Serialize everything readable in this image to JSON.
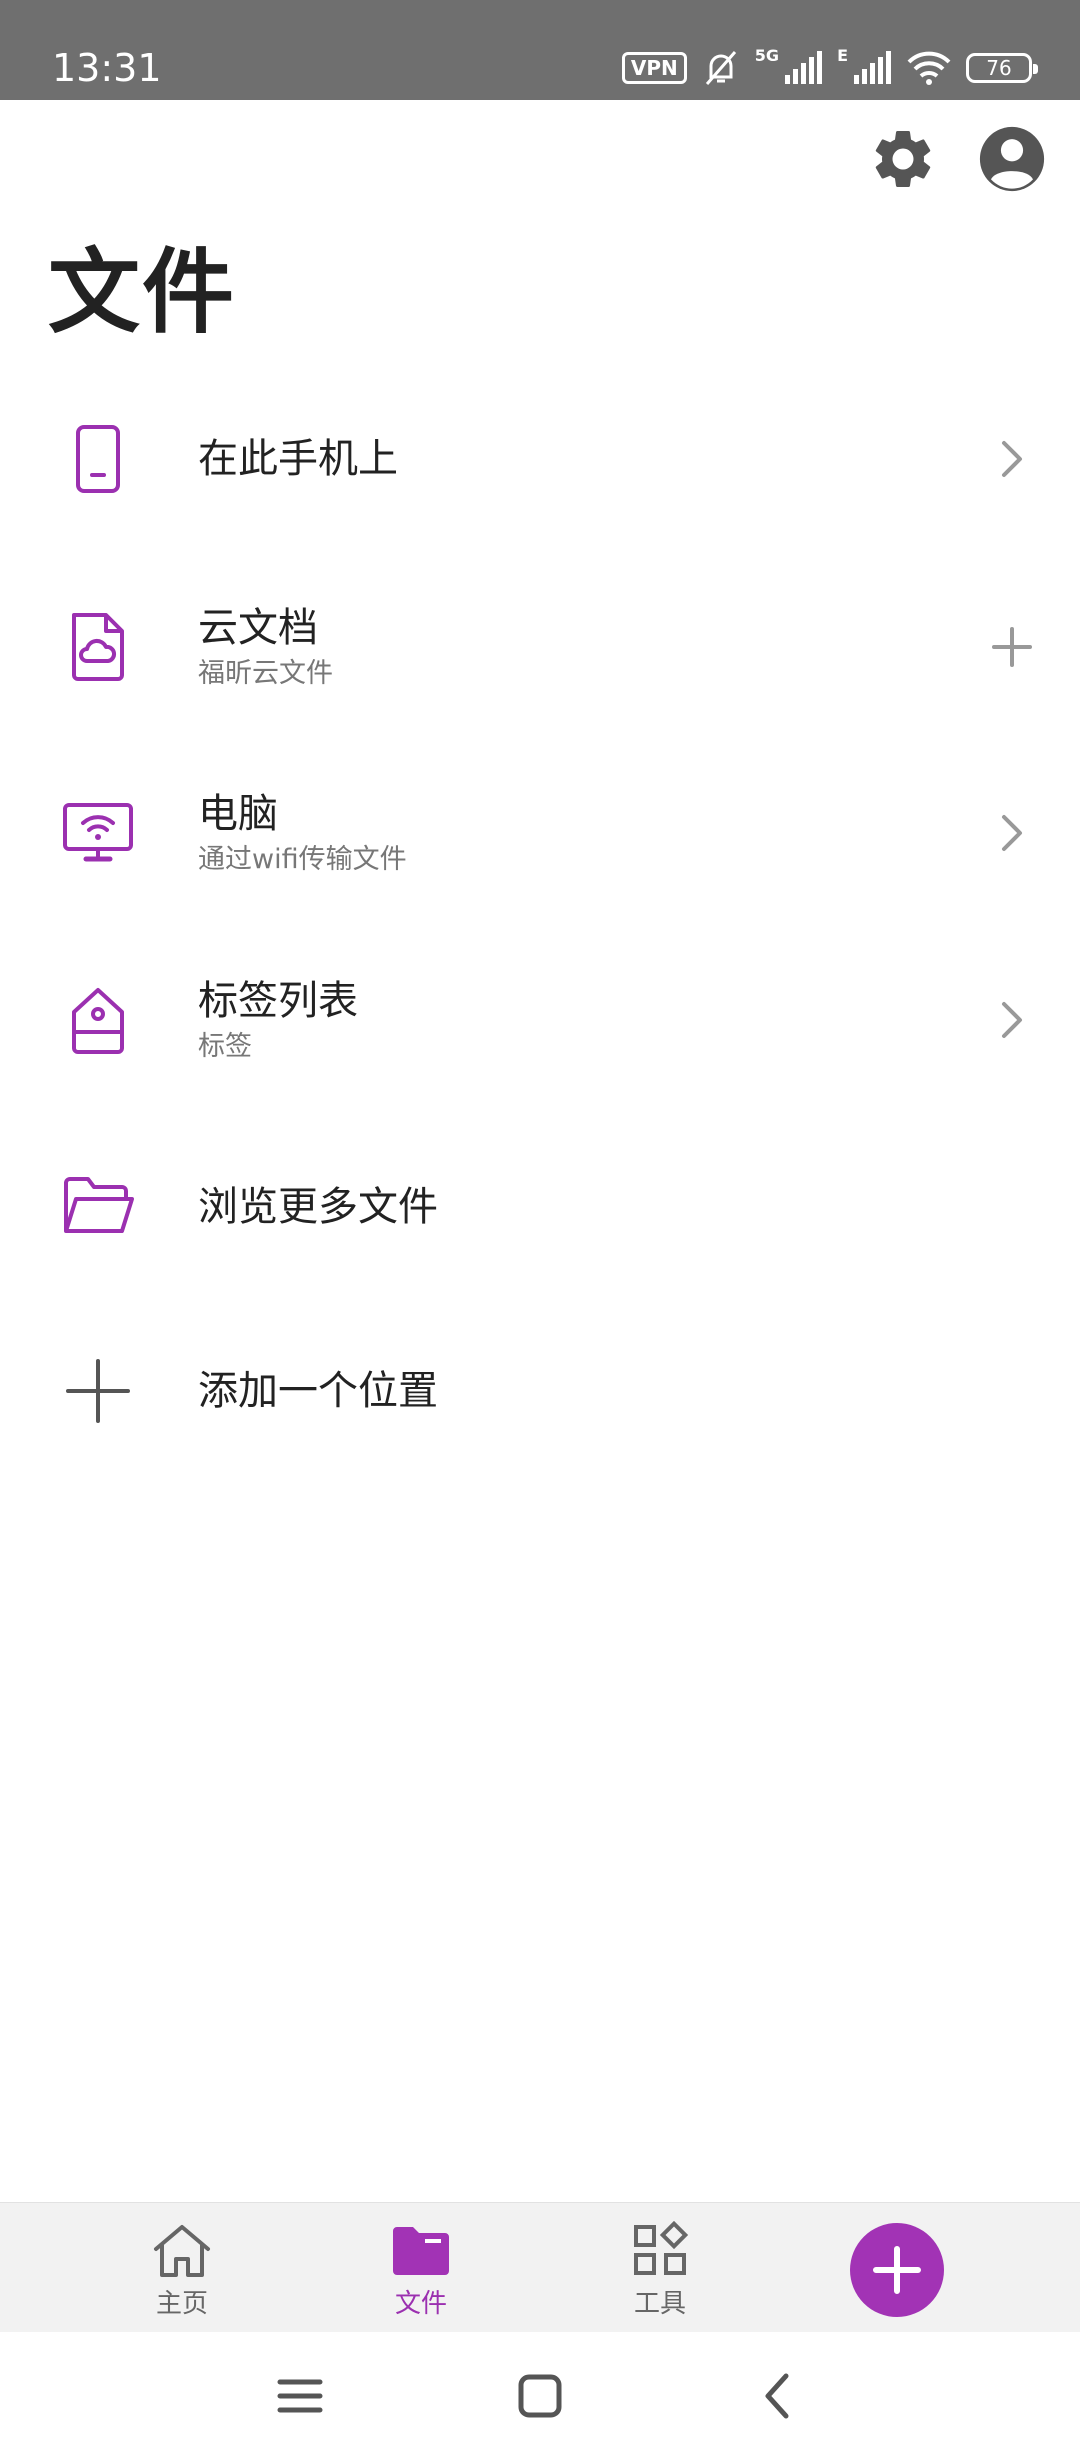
{
  "status_bar": {
    "time": "13:31",
    "vpn": "VPN",
    "net_5g": "5G",
    "net_e": "E",
    "battery": "76"
  },
  "header": {
    "settings_icon": "gear-icon",
    "account_icon": "account-circle-icon"
  },
  "page": {
    "title": "文件"
  },
  "locations": [
    {
      "title": "在此手机上",
      "subtitle": "",
      "icon": "phone-icon",
      "trailing": "chevron-right"
    },
    {
      "title": "云文档",
      "subtitle": "福昕云文件",
      "icon": "cloud-document-icon",
      "trailing": "plus"
    },
    {
      "title": "电脑",
      "subtitle": "通过wifi传输文件",
      "icon": "wifi-monitor-icon",
      "trailing": "chevron-right"
    },
    {
      "title": "标签列表",
      "subtitle": "标签",
      "icon": "tag-icon",
      "trailing": "chevron-right"
    },
    {
      "title": "浏览更多文件",
      "subtitle": "",
      "icon": "folder-open-icon",
      "trailing": ""
    },
    {
      "title": "添加一个位置",
      "subtitle": "",
      "icon": "plus-icon",
      "trailing": ""
    }
  ],
  "bottom_nav": {
    "items": [
      {
        "label": "主页",
        "icon": "home-icon",
        "active": false
      },
      {
        "label": "文件",
        "icon": "folder-icon",
        "active": true
      },
      {
        "label": "工具",
        "icon": "tools-grid-icon",
        "active": false
      }
    ],
    "fab_icon": "plus-icon"
  },
  "colors": {
    "accent": "#a233b5",
    "status_bar": "#6f6f6f",
    "text_primary": "#222222",
    "text_secondary": "#777777"
  }
}
